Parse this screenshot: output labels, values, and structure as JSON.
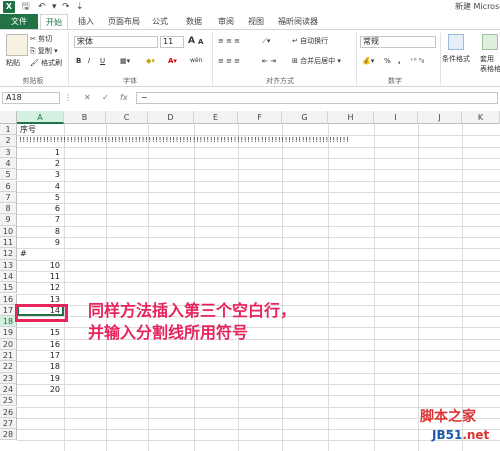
{
  "window": {
    "title": "新建 Microsc"
  },
  "ribbon_tabs": [
    "文件",
    "开始",
    "插入",
    "页面布局",
    "公式",
    "数据",
    "审阅",
    "视图",
    "福昕阅读器"
  ],
  "clipboard": {
    "paste": "粘贴",
    "cut": "剪切",
    "copy": "复制",
    "format_painter": "格式刷",
    "group": "剪贴板"
  },
  "font": {
    "name": "宋体",
    "size": "11",
    "group": "字体",
    "bold": "B",
    "italic": "I",
    "underline": "U",
    "grow": "A",
    "shrink": "A",
    "wen": "wén"
  },
  "alignment": {
    "wrap": "自动换行",
    "merge": "合并后居中",
    "group": "对齐方式"
  },
  "number": {
    "format": "常规",
    "percent": "%",
    "comma": ",",
    "group": "数字"
  },
  "styles": {
    "conditional": "条件格式",
    "table": "套用\n表格格"
  },
  "formula_bar": {
    "name_box": "A18",
    "cancel": "✕",
    "confirm": "✓",
    "fx": "fx",
    "content": "~"
  },
  "columns": [
    "A",
    "B",
    "C",
    "D",
    "E",
    "F",
    "G",
    "H",
    "I",
    "J",
    "K"
  ],
  "rows": [
    "1",
    "2",
    "3",
    "4",
    "5",
    "6",
    "7",
    "8",
    "9",
    "10",
    "11",
    "12",
    "13",
    "14",
    "15",
    "16",
    "17",
    "18",
    "19",
    "20",
    "21",
    "22",
    "23",
    "24",
    "25",
    "26",
    "27",
    "28"
  ],
  "cells": {
    "r1": "序号",
    "r2": "!!!!!!!!!!!!!!!!!!!!!!!!!!!!!!!!!!!!!!!!!!!!!!!!!!!!!!!!!!!!!!!!!!!!!!!!!!!!!!!!!!!!!!!!!!!!!!!!!",
    "r3": "1",
    "r4": "2",
    "r5": "3",
    "r6": "4",
    "r7": "5",
    "r8": "6",
    "r9": "7",
    "r10": "8",
    "r11": "9",
    "r12": "#",
    "r13": "10",
    "r14": "11",
    "r15": "12",
    "r16": "13",
    "r17": "14",
    "r18": "~",
    "r19": "15",
    "r20": "16",
    "r21": "17",
    "r22": "18",
    "r23": "19",
    "r24": "20"
  },
  "annotation": {
    "line1": "同样方法插入第三个空白行，",
    "line2": "并输入分割线所用符号"
  },
  "watermark": {
    "line1": "脚本之家",
    "line2_a": "JB51",
    "line2_b": ".net"
  },
  "colors": {
    "accent": "#217346",
    "annotation": "#e8245c"
  }
}
